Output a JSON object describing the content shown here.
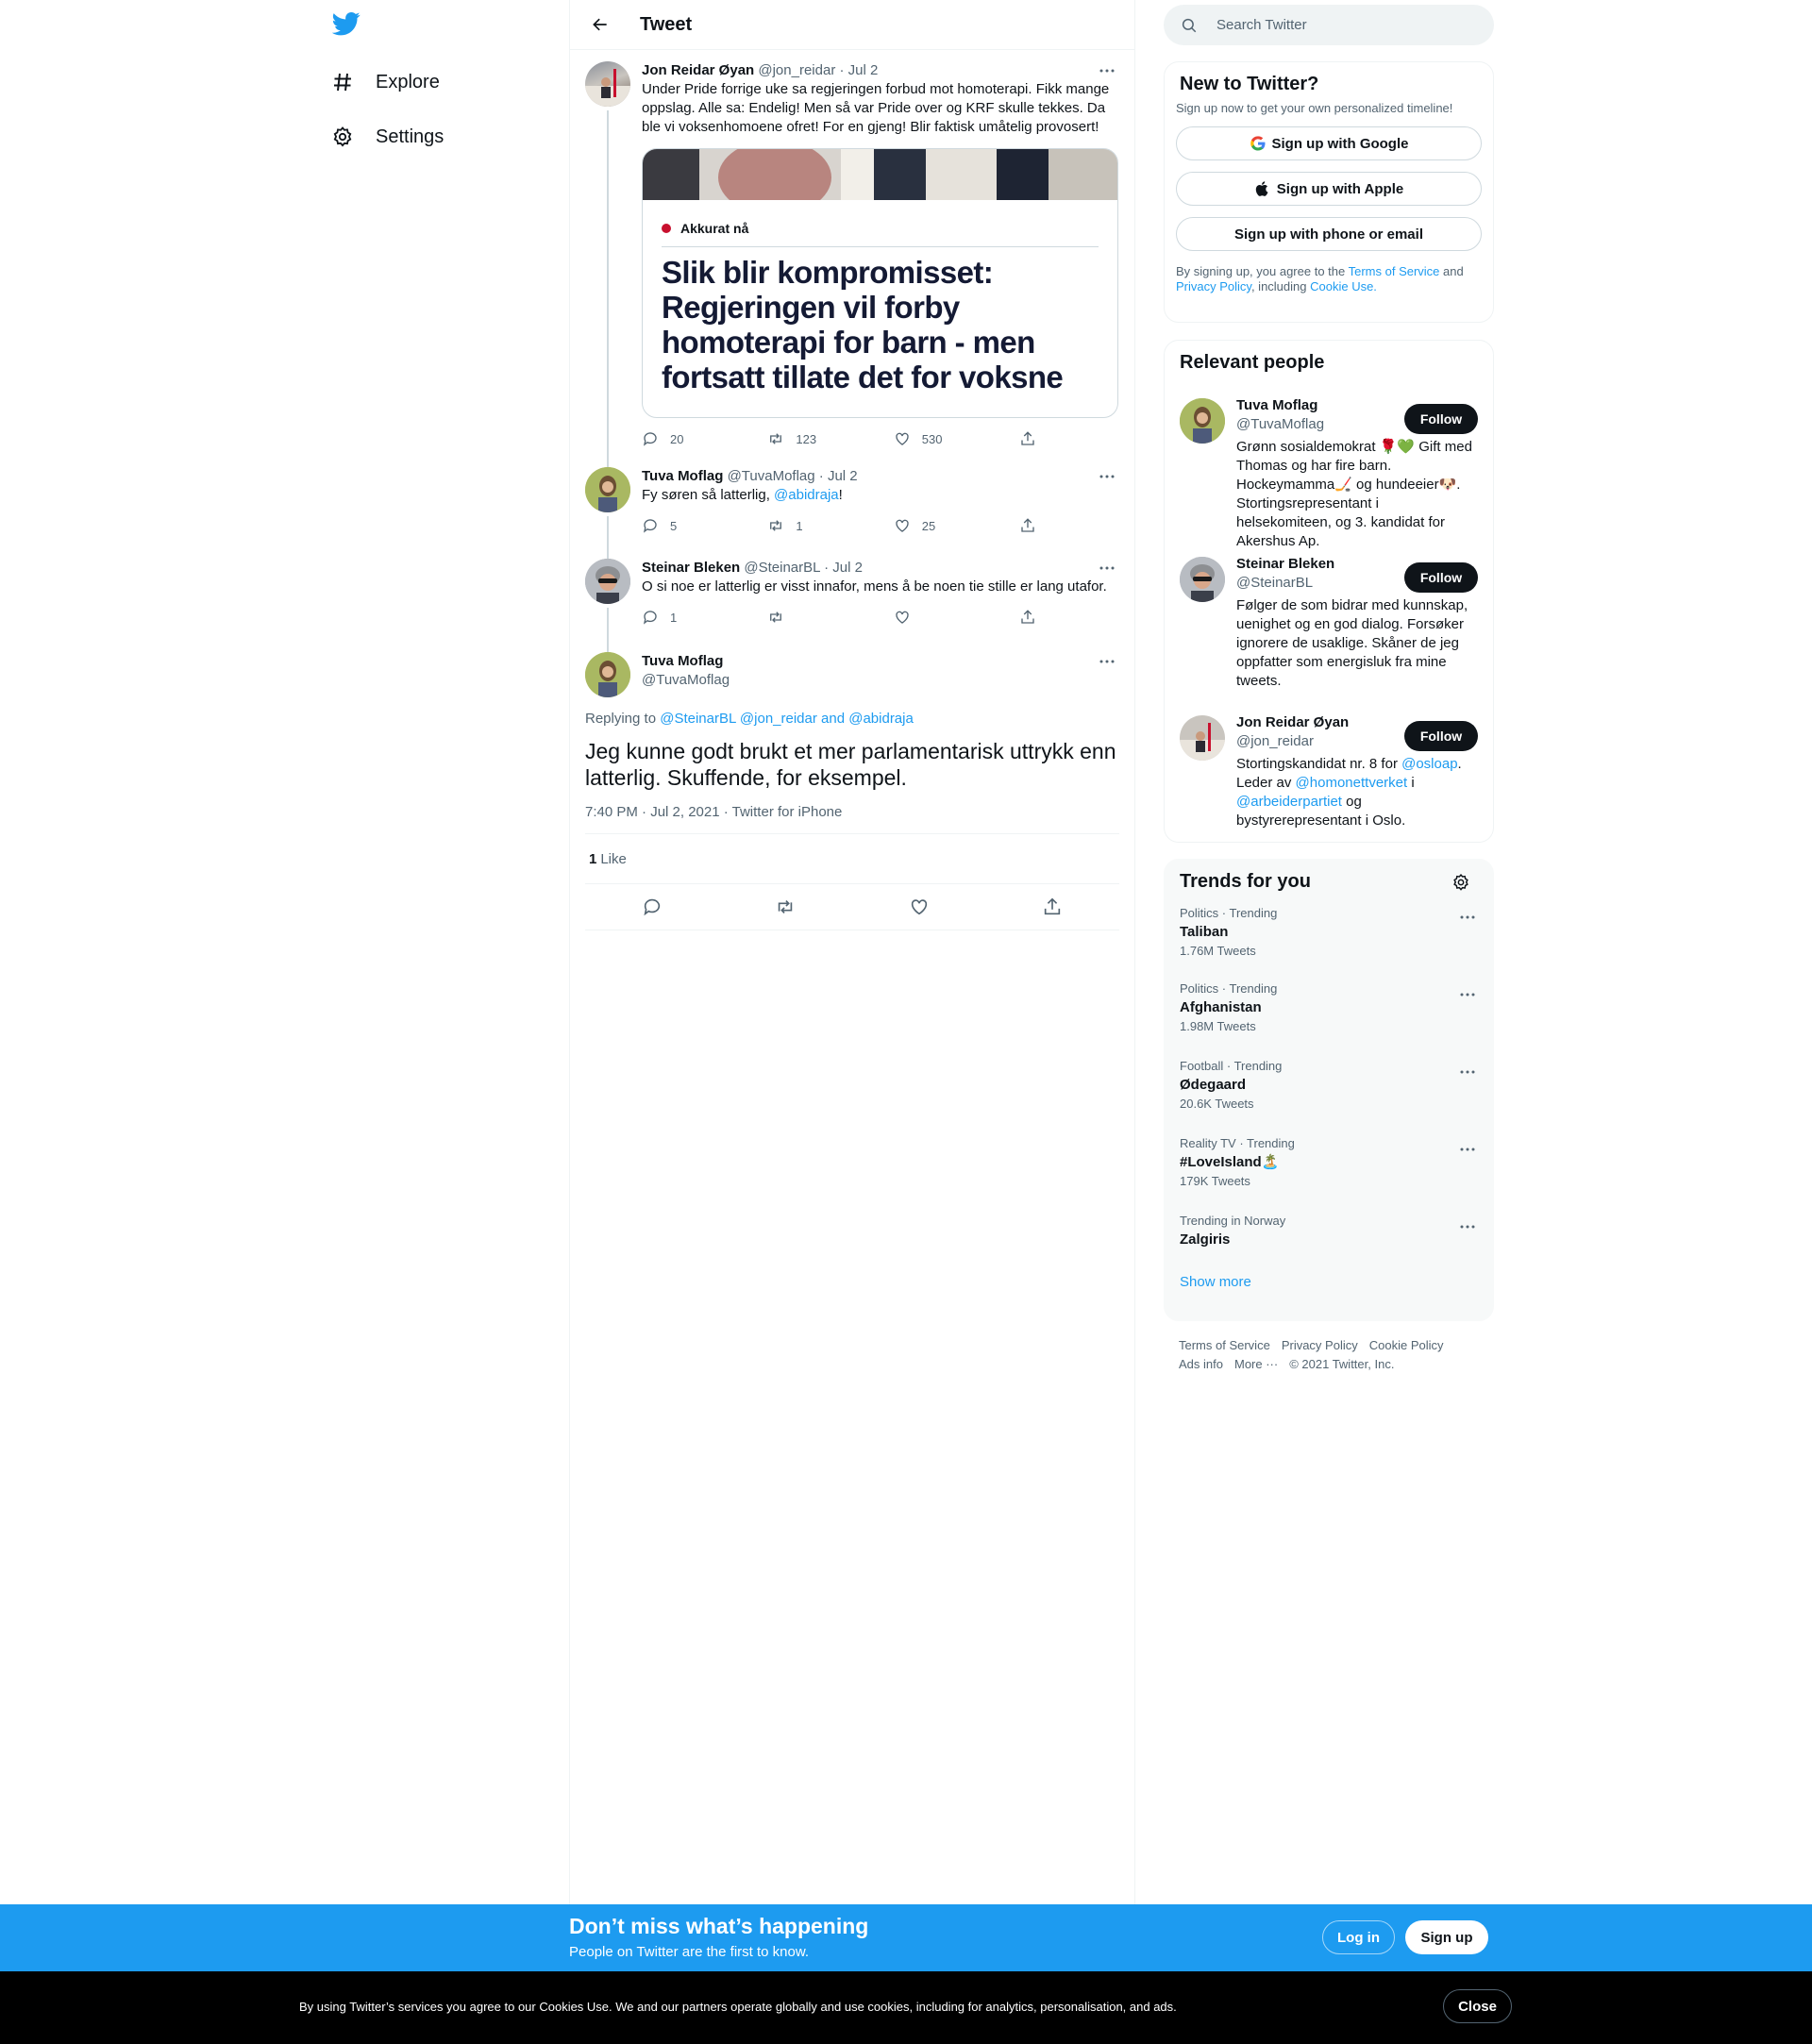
{
  "nav": {
    "explore_label": "Explore",
    "settings_label": "Settings"
  },
  "header": {
    "title": "Tweet"
  },
  "thread": [
    {
      "name": "Jon Reidar Øyan",
      "handle": "@jon_reidar",
      "date": "· Jul 2",
      "text": "Under Pride forrige uke sa regjeringen forbud mot homoterapi. Fikk mange oppslag. Alle sa: Endelig! Men så var Pride over og KRF skulle tekkes. Da ble vi voksenhomoene ofret! For en gjeng! Blir faktisk umåtelig provosert!",
      "card": {
        "tag": "Akkurat nå",
        "headline": "Slik blir kompromisset: Regjeringen vil forby homoterapi for barn - men fortsatt tillate det for voksne"
      },
      "replies": "20",
      "retweets": "123",
      "likes": "530"
    },
    {
      "name": "Tuva Moflag",
      "handle": "@TuvaMoflag",
      "date": "· Jul 2",
      "text_before": "Fy søren så latterlig, ",
      "mention": "@abidraja",
      "text_after": "!",
      "replies": "5",
      "retweets": "1",
      "likes": "25"
    },
    {
      "name": "Steinar Bleken",
      "handle": "@SteinarBL",
      "date": "· Jul 2",
      "text": "O si noe er latterlig er visst innafor, mens å be noen tie stille er lang utafor.",
      "replies": "1",
      "retweets": "",
      "likes": ""
    }
  ],
  "focus": {
    "name": "Tuva Moflag",
    "handle": "@TuvaMoflag",
    "replying_label": "Replying to",
    "replying_to": "@SteinarBL @jon_reidar and @abidraja",
    "text": "Jeg kunne godt brukt et mer parlamentarisk uttrykk enn latterlig. Skuffende, for eksempel.",
    "meta": "7:40 PM · Jul 2, 2021 · Twitter for iPhone",
    "like_count": "1",
    "like_label": "Like"
  },
  "search": {
    "placeholder": "Search Twitter"
  },
  "new_to_twitter": {
    "title": "New to Twitter?",
    "subtitle": "Sign up now to get your own personalized timeline!",
    "google_label": "Sign up with Google",
    "apple_label": "Sign up with Apple",
    "phone_label": "Sign up with phone or email",
    "legal_1": "By signing up, you agree to the ",
    "terms": "Terms of Service",
    "legal_2": " and ",
    "privacy": "Privacy Policy",
    "legal_3": ", including ",
    "cookie": "Cookie Use."
  },
  "relevant": {
    "title": "Relevant people",
    "follow_label": "Follow",
    "people": [
      {
        "name": "Tuva Moflag",
        "handle": "@TuvaMoflag",
        "bio": "Grønn sosialdemokrat 🌹💚 Gift med Thomas og har fire barn. Hockeymamma🏒 og hundeeier🐶. Stortingsrepresentant i helsekomiteen, og 3. kandidat for Akershus Ap."
      },
      {
        "name": "Steinar Bleken",
        "handle": "@SteinarBL",
        "bio": "Følger de som bidrar med kunnskap, uenighet og en god dialog. Forsøker ignorere de usaklige. Skåner de jeg oppfatter som energisluk fra mine tweets."
      },
      {
        "name": "Jon Reidar Øyan",
        "handle": "@jon_reidar",
        "bio_1": "Stortingskandidat nr. 8 for ",
        "m1": "@osloap",
        "bio_2": ". Leder av ",
        "m2": "@homonettverket",
        "bio_3": " i ",
        "m3": "@arbeiderpartiet",
        "bio_4": " og bystyrerepresentant i Oslo."
      }
    ]
  },
  "trends": {
    "title": "Trends for you",
    "items": [
      {
        "meta": "Politics · Trending",
        "name": "Taliban",
        "count": "1.76M Tweets"
      },
      {
        "meta": "Politics · Trending",
        "name": "Afghanistan",
        "count": "1.98M Tweets"
      },
      {
        "meta": "Football · Trending",
        "name": "Ødegaard",
        "count": "20.6K Tweets"
      },
      {
        "meta": "Reality TV · Trending",
        "name": "#LoveIsland🏝️",
        "count": "179K Tweets"
      },
      {
        "meta": "Trending in Norway",
        "name": "Zalgiris",
        "count": ""
      }
    ],
    "show_more": "Show more"
  },
  "footer": {
    "terms": "Terms of Service",
    "privacy": "Privacy Policy",
    "cookie": "Cookie Policy",
    "ads": "Ads info",
    "more": "More ···",
    "copyright": "© 2021 Twitter, Inc."
  },
  "bottom_bar": {
    "title": "Don’t miss what’s happening",
    "subtitle": "People on Twitter are the first to know.",
    "login": "Log in",
    "signup": "Sign up"
  },
  "cookie_bar": {
    "text": "By using Twitter’s services you agree to our Cookies Use. We and our partners operate globally and use cookies, including for analytics, personalisation, and ads.",
    "close": "Close"
  },
  "colors": {
    "accent": "#1d9bf0",
    "text": "#0f1419",
    "muted": "#536471",
    "border": "#eff3f4"
  }
}
